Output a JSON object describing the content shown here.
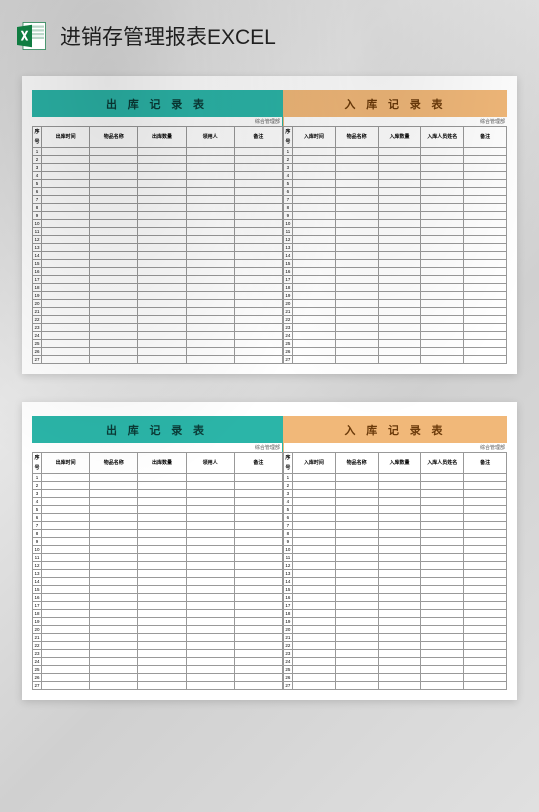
{
  "header": {
    "title": "进销存管理报表EXCEL",
    "icon": "excel-icon"
  },
  "sheet": {
    "left": {
      "title": "出 库 记 录 表",
      "subtitle": "综合管理部",
      "columns": [
        "序号",
        "出库时间",
        "物品名称",
        "出库数量",
        "领用人",
        "备注"
      ],
      "row_count": 27
    },
    "right": {
      "title": "入 库 记 录 表",
      "subtitle": "综合管理部",
      "columns": [
        "序号",
        "入库时间",
        "物品名称",
        "入库数量",
        "入库人员姓名",
        "备注"
      ],
      "row_count": 27
    }
  },
  "chart_data": [
    {
      "type": "table",
      "title": "出库记录表",
      "columns": [
        "序号",
        "出库时间",
        "物品名称",
        "出库数量",
        "领用人",
        "备注"
      ],
      "rows": []
    },
    {
      "type": "table",
      "title": "入库记录表",
      "columns": [
        "序号",
        "入库时间",
        "物品名称",
        "入库数量",
        "入库人员姓名",
        "备注"
      ],
      "rows": []
    }
  ]
}
